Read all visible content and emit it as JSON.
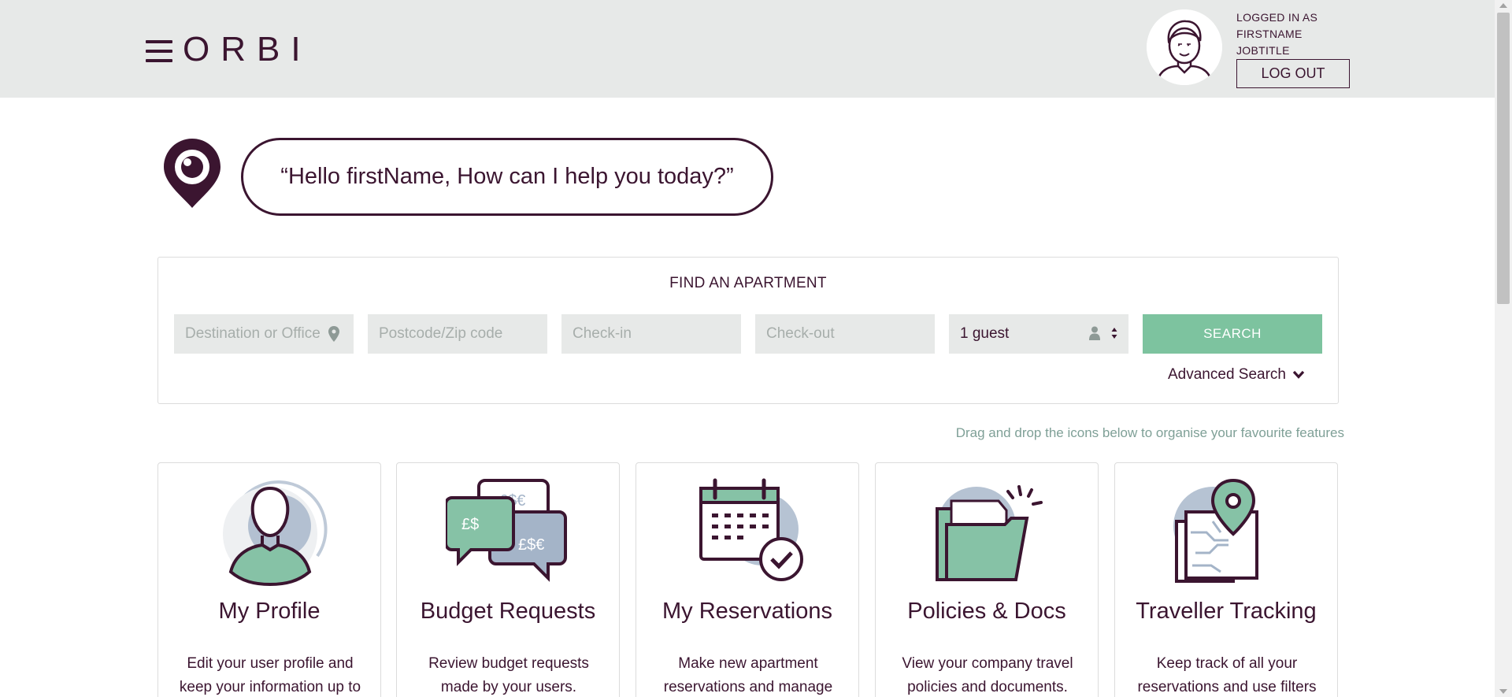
{
  "header": {
    "logo": "ORBI",
    "user_line1": "LOGGED IN AS",
    "user_line2": "FIRSTNAME",
    "user_line3": "JOBTITLE",
    "logout_label": "LOG OUT"
  },
  "greeting": {
    "text": "“Hello firstName, How can I help you today?”"
  },
  "search": {
    "title": "FIND AN APARTMENT",
    "destination_placeholder": "Destination or Office",
    "postcode_placeholder": "Postcode/Zip code",
    "checkin_placeholder": "Check-in",
    "checkout_placeholder": "Check-out",
    "guests_value": "1 guest",
    "search_label": "SEARCH",
    "advanced_label": "Advanced Search"
  },
  "hint": "Drag and drop the icons below to organise your favourite features",
  "cards": [
    {
      "title": "My Profile",
      "desc": "Edit your user profile and keep your information up to",
      "icon": "profile-icon"
    },
    {
      "title": "Budget Requests",
      "desc": "Review budget requests made by your users.",
      "icon": "budget-icon"
    },
    {
      "title": "My Reservations",
      "desc": "Make new apartment reservations and manage your",
      "icon": "calendar-icon"
    },
    {
      "title": "Policies & Docs",
      "desc": "View your company travel policies and documents.",
      "icon": "folder-icon"
    },
    {
      "title": "Traveller Tracking",
      "desc": "Keep track of all your reservations and use filters to",
      "icon": "map-pin-icon"
    }
  ],
  "colors": {
    "brand": "#3b1530",
    "accent": "#7dc39f",
    "header_bg": "#e7e9e8"
  }
}
